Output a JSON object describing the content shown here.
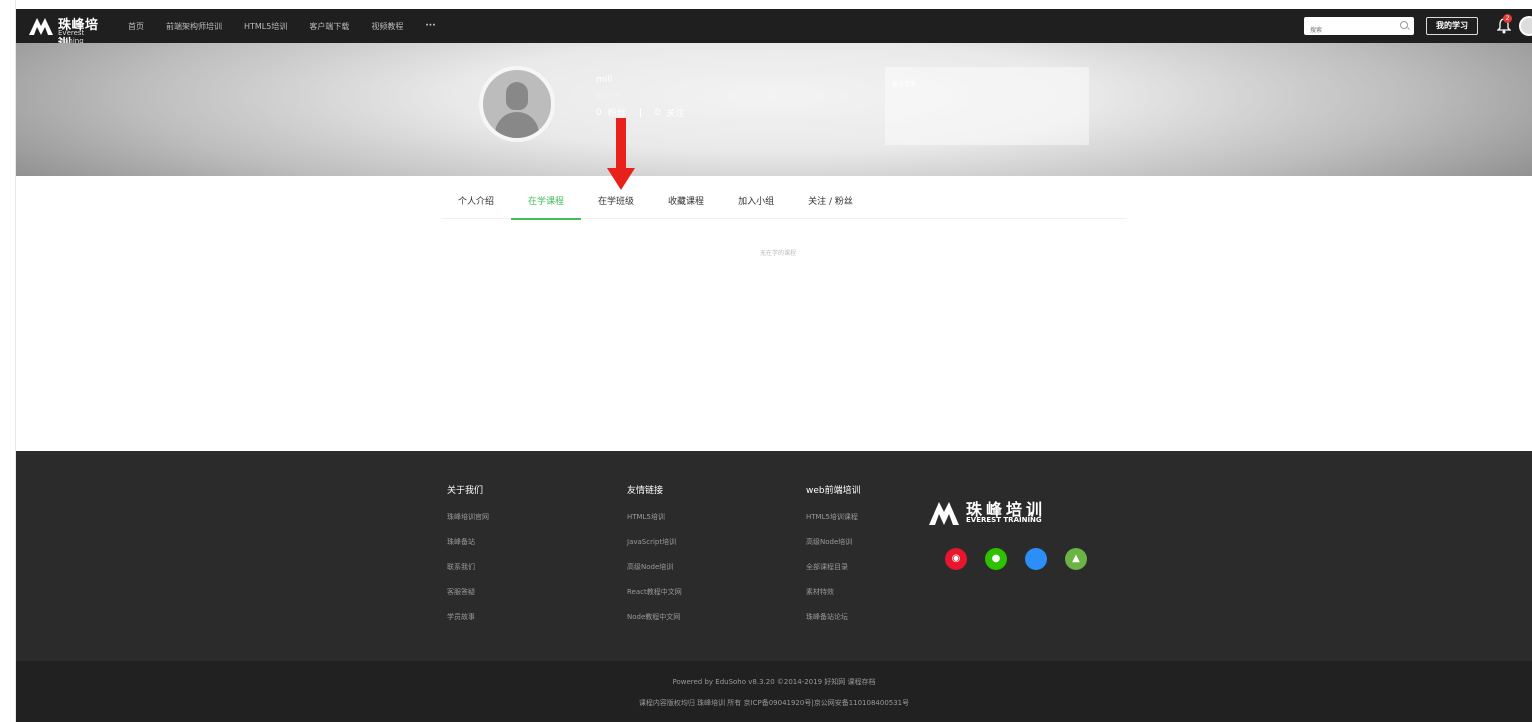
{
  "nav": {
    "logo_cn": "珠峰培训",
    "logo_en": "Everest Traning",
    "links": [
      "首页",
      "前端架构师培训",
      "HTML5培训",
      "客户端下载",
      "视频教程"
    ],
    "more": "···",
    "search_placeholder": "搜索",
    "my_study": "我的学习",
    "notification_count": "2"
  },
  "profile": {
    "username": "mili",
    "title": "暂无头衔",
    "fans_count": "0",
    "fans_label": "粉丝",
    "follow_count": "0",
    "follow_label": "关注",
    "signature": "暂无签名"
  },
  "tabs": [
    "个人介绍",
    "在学课程",
    "在学班级",
    "收藏课程",
    "加入小组",
    "关注 / 粉丝"
  ],
  "active_tab": "在学课程",
  "empty_note": "无在学的课程",
  "footer": {
    "columns": [
      {
        "title": "关于我们",
        "items": [
          "珠峰培训官网",
          "珠峰备站",
          "联系我们",
          "客服答疑",
          "学员故事"
        ]
      },
      {
        "title": "友情链接",
        "items": [
          "HTML5培训",
          "JavaScript培训",
          "高级Node培训",
          "React教程中文网",
          "Node教程中文网"
        ]
      },
      {
        "title": "web前端培训",
        "items": [
          "HTML5培训课程",
          "高级Node培训",
          "全部课程目录",
          "素材特效",
          "珠峰备站论坛"
        ]
      }
    ],
    "logo_cn": "珠峰培训",
    "logo_en": "EVEREST TRAINING",
    "social": [
      {
        "name": "weibo-icon",
        "glyph": "◉",
        "color": "#e6162d"
      },
      {
        "name": "wechat-icon",
        "glyph": "●",
        "color": "#2dc100"
      },
      {
        "name": "apple-icon",
        "glyph": "",
        "color": "#2c8ef8"
      },
      {
        "name": "android-icon",
        "glyph": "▲",
        "color": "#6ab344"
      }
    ],
    "powered": "Powered by EduSoho v8.3.20 ©2014-2019   好知网   课程存档",
    "copyright": "课程内容版权均归 珠峰培训 所有    京ICP备09041920号|京公网安备110108400531号"
  }
}
